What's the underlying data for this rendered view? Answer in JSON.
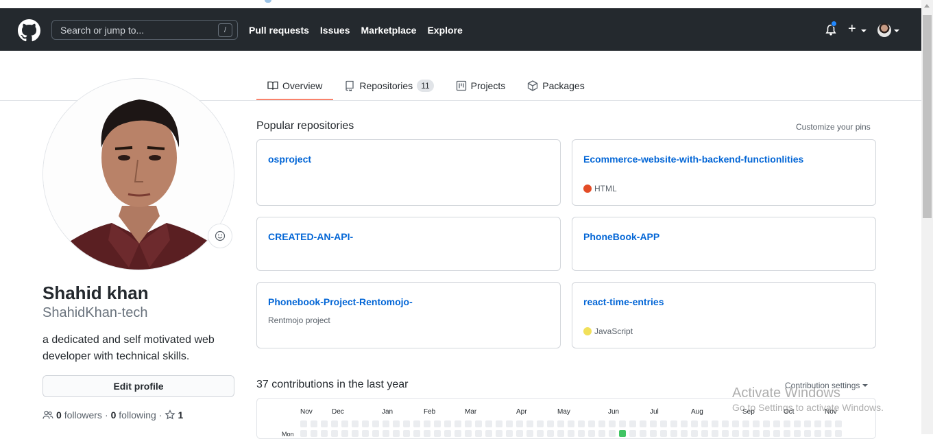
{
  "header": {
    "search_placeholder": "Search or jump to...",
    "search_shortcut": "/",
    "nav": [
      "Pull requests",
      "Issues",
      "Marketplace",
      "Explore"
    ],
    "plus_label": "+"
  },
  "tabs": [
    {
      "label": "Overview",
      "icon": "book-icon",
      "active": true
    },
    {
      "label": "Repositories",
      "icon": "repo-icon",
      "count": "11"
    },
    {
      "label": "Projects",
      "icon": "project-icon"
    },
    {
      "label": "Packages",
      "icon": "package-icon"
    }
  ],
  "profile": {
    "name": "Shahid khan",
    "login": "ShahidKhan-tech",
    "bio": "a dedicated and self motivated web developer with technical skills.",
    "edit_label": "Edit profile",
    "followers_count": "0",
    "followers_label": "followers",
    "following_count": "0",
    "following_label": "following",
    "separator": "·",
    "stars_count": "1"
  },
  "popular": {
    "title": "Popular repositories",
    "customize": "Customize your pins",
    "repos": [
      {
        "name": "osproject",
        "desc": "",
        "lang": ""
      },
      {
        "name": "Ecommerce-website-with-backend-functionlities",
        "desc": "",
        "lang": "HTML",
        "lang_color": "#e34c26"
      },
      {
        "name": "CREATED-AN-API-",
        "desc": "",
        "lang": ""
      },
      {
        "name": "PhoneBook-APP",
        "desc": "",
        "lang": ""
      },
      {
        "name": "Phonebook-Project-Rentomojo-",
        "desc": "Rentmojo project",
        "lang": ""
      },
      {
        "name": "react-time-entries",
        "desc": "",
        "lang": "JavaScript",
        "lang_color": "#f1e05a"
      }
    ]
  },
  "contributions": {
    "title": "37 contributions in the last year",
    "settings": "Contribution settings",
    "months": [
      "Nov",
      "Dec",
      "Jan",
      "Feb",
      "Mar",
      "Apr",
      "May",
      "Jun",
      "Jul",
      "Aug",
      "Sep",
      "Oct",
      "Nov"
    ],
    "day_label": "Mon"
  },
  "watermark": {
    "line1": "Activate Windows",
    "line2": "Go to Settings to activate Windows."
  },
  "colors": {
    "header_bg": "#24292e",
    "link": "#0366d6",
    "tab_underline": "#f9826c"
  }
}
